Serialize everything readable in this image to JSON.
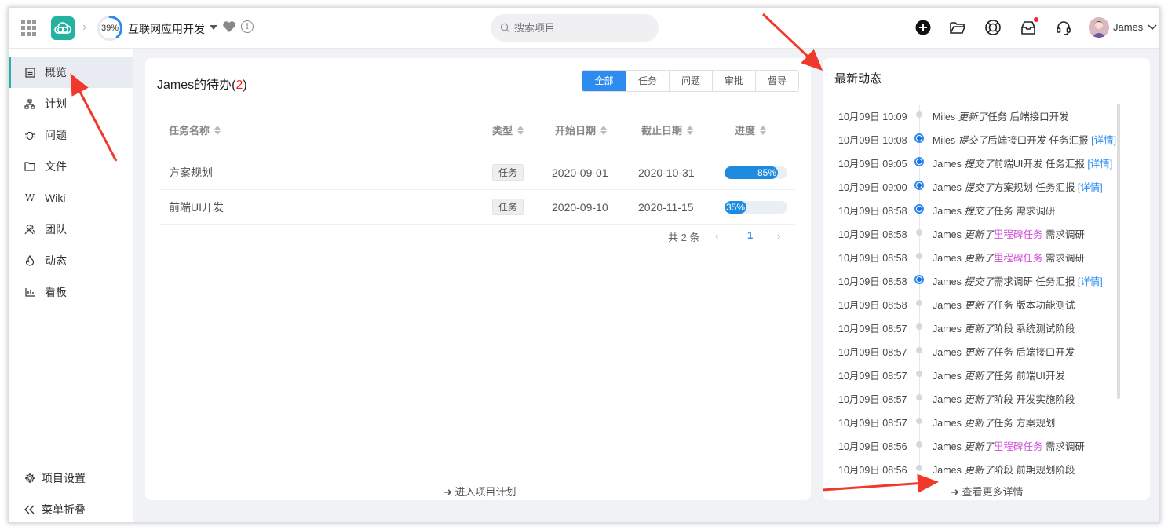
{
  "header": {
    "progress_percent": 39,
    "progress_label": "39%",
    "project_name": "互联网应用开发",
    "search_placeholder": "搜索项目",
    "user_name": "James"
  },
  "sidebar": {
    "items": [
      {
        "label": "概览",
        "icon": "overview-icon"
      },
      {
        "label": "计划",
        "icon": "plan-icon"
      },
      {
        "label": "问题",
        "icon": "bug-icon"
      },
      {
        "label": "文件",
        "icon": "folder-icon"
      },
      {
        "label": "Wiki",
        "icon": "wiki-icon"
      },
      {
        "label": "团队",
        "icon": "team-icon"
      },
      {
        "label": "动态",
        "icon": "fire-icon"
      },
      {
        "label": "看板",
        "icon": "chart-icon"
      }
    ],
    "settings_label": "项目设置",
    "collapse_label": "菜单折叠"
  },
  "todo": {
    "title_prefix": "James的待办(",
    "count": "2",
    "title_suffix": ")",
    "filters": [
      "全部",
      "任务",
      "问题",
      "审批",
      "督导"
    ],
    "active_filter": 0,
    "columns": [
      "任务名称",
      "类型",
      "开始日期",
      "截止日期",
      "进度"
    ],
    "rows": [
      {
        "name": "方案规划",
        "type": "任务",
        "start": "2020-09-01",
        "end": "2020-10-31",
        "progress": 85,
        "progress_label": "85%"
      },
      {
        "name": "前端UI开发",
        "type": "任务",
        "start": "2020-09-10",
        "end": "2020-11-15",
        "progress": 35,
        "progress_label": "35%"
      }
    ],
    "total_label": "共 2 条",
    "page": "1",
    "enter_plan_label": "进入项目计划"
  },
  "activity": {
    "title": "最新动态",
    "more_label": "查看更多详情",
    "items": [
      {
        "time": "10月09日 10:09",
        "user": "Miles",
        "verb": "更新了",
        "kind": "任务",
        "target": "后端接口开发",
        "detail": "",
        "node": "small"
      },
      {
        "time": "10月09日 10:08",
        "user": "Miles",
        "verb": "提交了",
        "kind": "后端接口开发",
        "target": "任务汇报",
        "detail": "[详情]",
        "node": "big"
      },
      {
        "time": "10月09日 09:05",
        "user": "James",
        "verb": "提交了",
        "kind": "前端UI开发",
        "target": "任务汇报",
        "detail": "[详情]",
        "node": "big"
      },
      {
        "time": "10月09日 09:00",
        "user": "James",
        "verb": "提交了",
        "kind": "方案规划",
        "target": "任务汇报",
        "detail": "[详情]",
        "node": "big"
      },
      {
        "time": "10月09日 08:58",
        "user": "James",
        "verb": "提交了",
        "kind": "任务",
        "target": "需求调研",
        "detail": "",
        "node": "big"
      },
      {
        "time": "10月09日 08:58",
        "user": "James",
        "verb": "更新了",
        "kind": "里程碑任务",
        "target": "需求调研",
        "detail": "",
        "node": "small",
        "pink": true
      },
      {
        "time": "10月09日 08:58",
        "user": "James",
        "verb": "更新了",
        "kind": "里程碑任务",
        "target": "需求调研",
        "detail": "",
        "node": "small",
        "pink": true
      },
      {
        "time": "10月09日 08:58",
        "user": "James",
        "verb": "提交了",
        "kind": "需求调研",
        "target": "任务汇报",
        "detail": "[详情]",
        "node": "big"
      },
      {
        "time": "10月09日 08:58",
        "user": "James",
        "verb": "更新了",
        "kind": "任务",
        "target": "版本功能测试",
        "detail": "",
        "node": "small"
      },
      {
        "time": "10月09日 08:57",
        "user": "James",
        "verb": "更新了",
        "kind": "阶段",
        "target": "系统测试阶段",
        "detail": "",
        "node": "small"
      },
      {
        "time": "10月09日 08:57",
        "user": "James",
        "verb": "更新了",
        "kind": "任务",
        "target": "后端接口开发",
        "detail": "",
        "node": "small"
      },
      {
        "time": "10月09日 08:57",
        "user": "James",
        "verb": "更新了",
        "kind": "任务",
        "target": "前端UI开发",
        "detail": "",
        "node": "small"
      },
      {
        "time": "10月09日 08:57",
        "user": "James",
        "verb": "更新了",
        "kind": "阶段",
        "target": "开发实施阶段",
        "detail": "",
        "node": "small"
      },
      {
        "time": "10月09日 08:57",
        "user": "James",
        "verb": "更新了",
        "kind": "任务",
        "target": "方案规划",
        "detail": "",
        "node": "small"
      },
      {
        "time": "10月09日 08:56",
        "user": "James",
        "verb": "更新了",
        "kind": "里程碑任务",
        "target": "需求调研",
        "detail": "",
        "node": "small",
        "pink": true
      },
      {
        "time": "10月09日 08:56",
        "user": "James",
        "verb": "更新了",
        "kind": "阶段",
        "target": "前期规划阶段",
        "detail": "",
        "node": "small"
      }
    ]
  },
  "colors": {
    "accent": "#2e8cf0",
    "brand": "#25b3a1",
    "milestone": "#d04ed8",
    "annotation_arrow": "#f0392b"
  }
}
